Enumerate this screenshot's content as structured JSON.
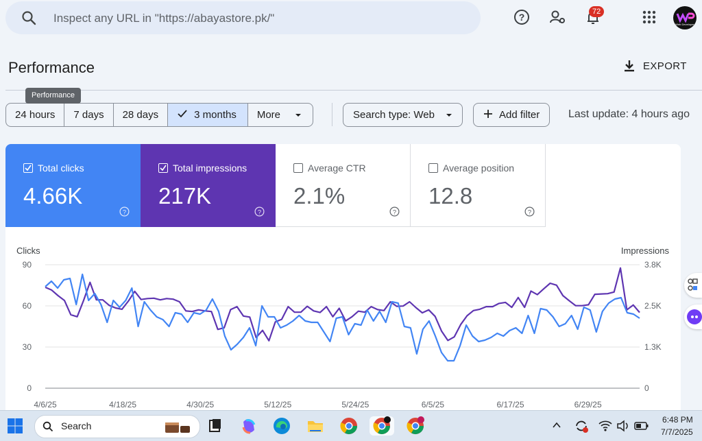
{
  "search": {
    "placeholder": "Inspect any URL in \"https://abayastore.pk/\""
  },
  "header": {
    "notifications_count": "72",
    "avatar_text": "Web Developer"
  },
  "page": {
    "title": "Performance",
    "export_label": "EXPORT",
    "tooltip": "Performance"
  },
  "filters": {
    "date_ranges": [
      "24 hours",
      "7 days",
      "28 days",
      "3 months",
      "More"
    ],
    "selected": "3 months",
    "search_type": "Search type: Web",
    "add_filter": "Add filter",
    "last_update": "Last update: 4 hours ago"
  },
  "metrics": [
    {
      "label": "Total clicks",
      "value": "4.66K",
      "checked": true,
      "color": "#4285f4"
    },
    {
      "label": "Total impressions",
      "value": "217K",
      "checked": true,
      "color": "#5e35b1"
    },
    {
      "label": "Average CTR",
      "value": "2.1%",
      "checked": false,
      "color": "#ffffff"
    },
    {
      "label": "Average position",
      "value": "12.8",
      "checked": false,
      "color": "#ffffff"
    }
  ],
  "chart_data": {
    "type": "line",
    "left_axis_label": "Clicks",
    "right_axis_label": "Impressions",
    "left_ticks": [
      "90",
      "60",
      "30",
      "0"
    ],
    "right_ticks": [
      "3.8K",
      "2.5K",
      "1.3K",
      "0"
    ],
    "ylim_left": [
      0,
      90
    ],
    "ylim_right": [
      0,
      3800
    ],
    "x_ticks": [
      "4/6/25",
      "4/18/25",
      "4/30/25",
      "5/12/25",
      "5/24/25",
      "6/5/25",
      "6/17/25",
      "6/29/25"
    ],
    "x_start": "4/6/25",
    "grid": true,
    "series": [
      {
        "name": "Clicks",
        "color": "#4285f4",
        "values": [
          74,
          78,
          73,
          79,
          80,
          61,
          83,
          64,
          69,
          61,
          48,
          64,
          59,
          64,
          73,
          45,
          63,
          57,
          52,
          50,
          45,
          55,
          54,
          48,
          55,
          54,
          57,
          65,
          56,
          38,
          28,
          32,
          37,
          44,
          31,
          60,
          52,
          52,
          44,
          46,
          49,
          53,
          49,
          48,
          48,
          41,
          34,
          51,
          52,
          39,
          47,
          46,
          57,
          49,
          56,
          48,
          63,
          62,
          45,
          44,
          25,
          43,
          49,
          38,
          26,
          20,
          20,
          31,
          46,
          38,
          34,
          35,
          37,
          40,
          38,
          42,
          44,
          40,
          53,
          40,
          58,
          57,
          52,
          45,
          47,
          53,
          43,
          59,
          57,
          41,
          56,
          62,
          65,
          66,
          55,
          54,
          51
        ],
        "labels_mapping": "clicks"
      },
      {
        "name": "Impressions",
        "color": "#5e35b1",
        "values": [
          3105,
          3020,
          2850,
          2700,
          2260,
          2200,
          2700,
          3260,
          2720,
          2720,
          2550,
          2470,
          2430,
          2680,
          2980,
          2730,
          2760,
          2770,
          2720,
          2760,
          2740,
          2660,
          2380,
          2360,
          2410,
          2380,
          2360,
          1810,
          1860,
          2420,
          2510,
          2220,
          2190,
          1560,
          1780,
          1460,
          2040,
          2120,
          2510,
          2340,
          2340,
          2520,
          2380,
          2330,
          2510,
          2200,
          2460,
          2070,
          2200,
          2370,
          2340,
          2510,
          2420,
          2390,
          2660,
          2520,
          2530,
          2660,
          2480,
          2320,
          2410,
          2210,
          1760,
          1470,
          1580,
          1960,
          2230,
          2390,
          2430,
          2510,
          2510,
          2610,
          2640,
          2490,
          2790,
          2490,
          2990,
          2880,
          3060,
          3230,
          3170,
          2850,
          2690,
          2540,
          2540,
          2570,
          2890,
          2900,
          2910,
          2960,
          3700,
          2410,
          2560,
          2330
        ],
        "labels_mapping": "impressions"
      }
    ]
  },
  "taskbar": {
    "search_label": "Search",
    "time": "6:48 PM",
    "date": "7/7/2025"
  }
}
